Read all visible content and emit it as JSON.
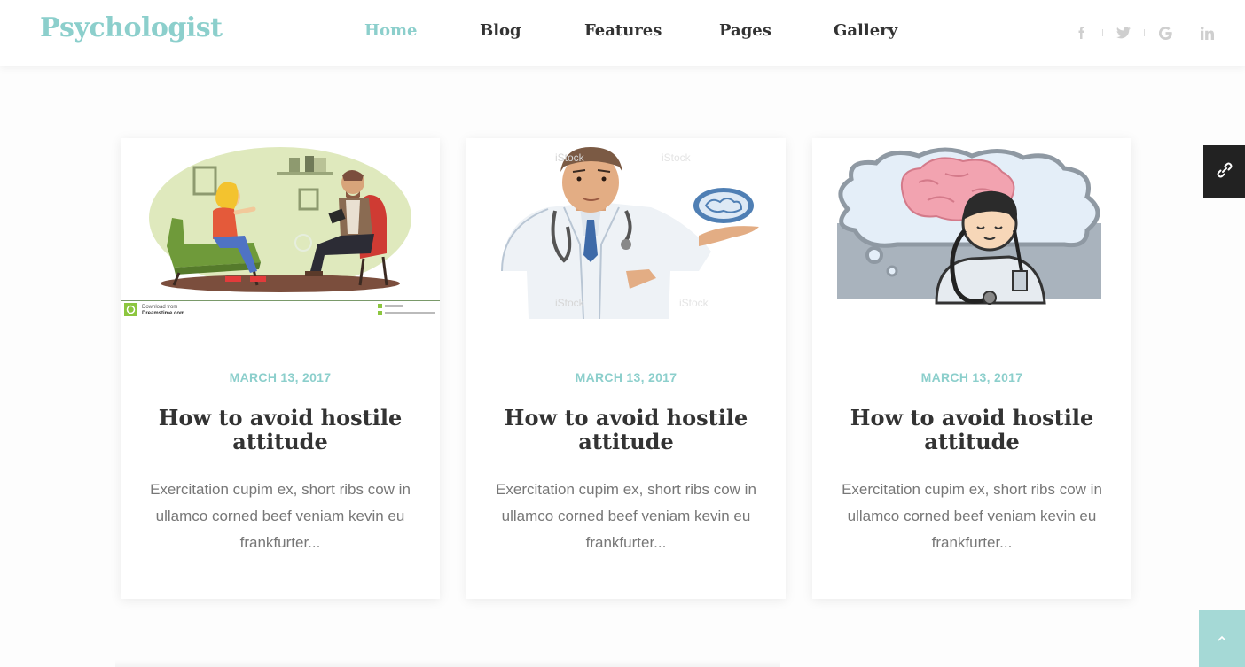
{
  "brand": {
    "logo_text": "Psychologist"
  },
  "nav": {
    "items": [
      {
        "label": "Home",
        "active": true
      },
      {
        "label": "Blog",
        "active": false
      },
      {
        "label": "Features",
        "active": false
      },
      {
        "label": "Pages",
        "active": false
      },
      {
        "label": "Gallery",
        "active": false
      }
    ]
  },
  "social": {
    "icons": [
      "facebook-icon",
      "twitter-icon",
      "google-icon",
      "linkedin-icon"
    ]
  },
  "posts": [
    {
      "image": "therapy-session-illustration",
      "image_caption_left": "Download from",
      "image_caption_brand": "Dreamstime.com",
      "date": "MARCH 13, 2017",
      "title": "How to avoid hostile attitude",
      "excerpt": "Exercitation cupim ex, short ribs cow in ullamco corned beef veniam kevin eu frankfurter..."
    },
    {
      "image": "doctor-holding-brain-illustration",
      "watermark": "iStock",
      "date": "MARCH 13, 2017",
      "title": "How to avoid hostile attitude",
      "excerpt": "Exercitation cupim ex, short ribs cow in ullamco corned beef veniam kevin eu frankfurter..."
    },
    {
      "image": "doctor-thinking-brain-illustration",
      "date": "MARCH 13, 2017",
      "title": "How to avoid hostile attitude",
      "excerpt": "Exercitation cupim ex, short ribs cow in ullamco corned beef veniam kevin eu frankfurter..."
    }
  ],
  "widgets": {
    "side_tab_icon": "link-icon",
    "back_to_top_icon": "chevron-up-icon"
  },
  "colors": {
    "accent": "#8ccfcc",
    "text": "#333333",
    "muted": "#777777",
    "dark": "#222222"
  }
}
